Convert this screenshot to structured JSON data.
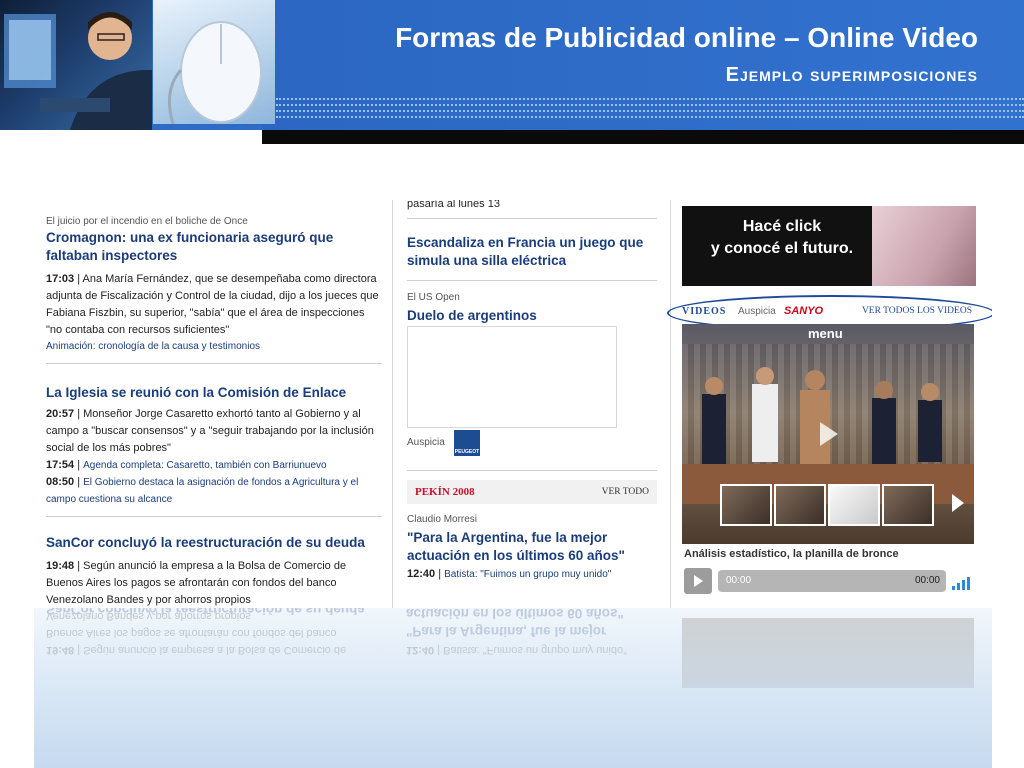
{
  "header": {
    "title": "Formas de Publicidad online – Online Video",
    "subtitle": "Ejemplo superimposiciones"
  },
  "col1": {
    "story1": {
      "kicker": "El juicio por el incendio en el boliche de Once",
      "headline": "Cromagnon: una ex funcionaria aseguró que faltaban inspectores",
      "time": "17:03",
      "body": "Ana María Fernández, que se desempeñaba como directora adjunta de Fiscalización y Control de la ciudad, dijo a los jueces que Fabiana Fiszbin, su superior, \"sabía\" que el área de inspecciones \"no contaba con recursos suficientes\"",
      "link": "Animación: cronología de la causa y testimonios"
    },
    "story2": {
      "headline": "La Iglesia se reunió con la Comisión de Enlace",
      "time": "20:57",
      "body": "Monseñor Jorge Casaretto exhortó tanto al Gobierno y al campo a \"buscar consensos\" y a \"seguir trabajando por la inclusión social de los más pobres\"",
      "sub1_time": "17:54",
      "sub1_text": "Agenda completa: Casaretto, también con Barriunuevo",
      "sub2_time": "08:50",
      "sub2_text": "El Gobierno destaca la asignación de fondos a Agricultura y el campo cuestiona su alcance"
    },
    "story3": {
      "headline": "SanCor concluyó la reestructuración de su deuda",
      "time": "19:48",
      "body": "Según anunció la empresa a la Bolsa de Comercio de Buenos Aires los pagos se afrontarán con fondos del banco Venezolano Bandes y por ahorros propios"
    }
  },
  "col2": {
    "top_fragment": "pasaría al lunes 13",
    "story1_headline": "Escandaliza en Francia un juego que simula una silla eléctrica",
    "story2_kicker": "El US Open",
    "story2_headline": "Duelo de argentinos",
    "auspicia": "Auspicia",
    "sponsor_logo": "PEUGEOT",
    "pekin_label": "PEKÍN 2008",
    "ver_todo": "VER TODO",
    "story3_kicker": "Claudio Morresi",
    "story3_headline": "\"Para la Argentina, fue la mejor actuación en los últimos 60 años\"",
    "story3_time": "12:40",
    "story3_link": "Batista: \"Fuimos un grupo muy unido\""
  },
  "col3": {
    "ad_line1": "Hacé click",
    "ad_line2": "y conocé el futuro.",
    "videos_label": "VIDEOS",
    "auspicia": "Auspicia",
    "sponsor": "SANYO",
    "ver_todos": "VER TODOS LOS VIDEOS",
    "menu_label": "menu",
    "caption": "Análisis estadístico,  la planilla de bronce",
    "time_start": "00:00",
    "time_end": "00:00"
  },
  "icons": [
    "play-icon",
    "next-arrow-icon",
    "volume-icon",
    "peugeot-logo",
    "sanyo-logo"
  ]
}
